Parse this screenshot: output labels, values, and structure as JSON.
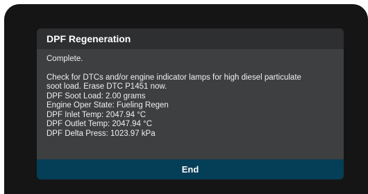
{
  "dialog": {
    "title": "DPF Regeneration",
    "status": "Complete.",
    "instruction": "Check for DTCs and/or engine indicator lamps for high diesel particulate\nsoot load. Erase DTC P1451 now.",
    "readings": [
      "DPF Soot Load: 2.00 grams",
      "Engine Oper State: Fueling Regen",
      "DPF Inlet Temp: 2047.94 °C",
      "DPF Outlet Temp: 2047.94 °C",
      "DPF Delta Press: 1023.97 kPa"
    ],
    "end_label": "End"
  },
  "colors": {
    "screen_background": "#151515",
    "dialog_background": "#3d3f40",
    "header_background": "#2e2f31",
    "footer_button": "#053e57",
    "text": "#f0f0f0"
  }
}
